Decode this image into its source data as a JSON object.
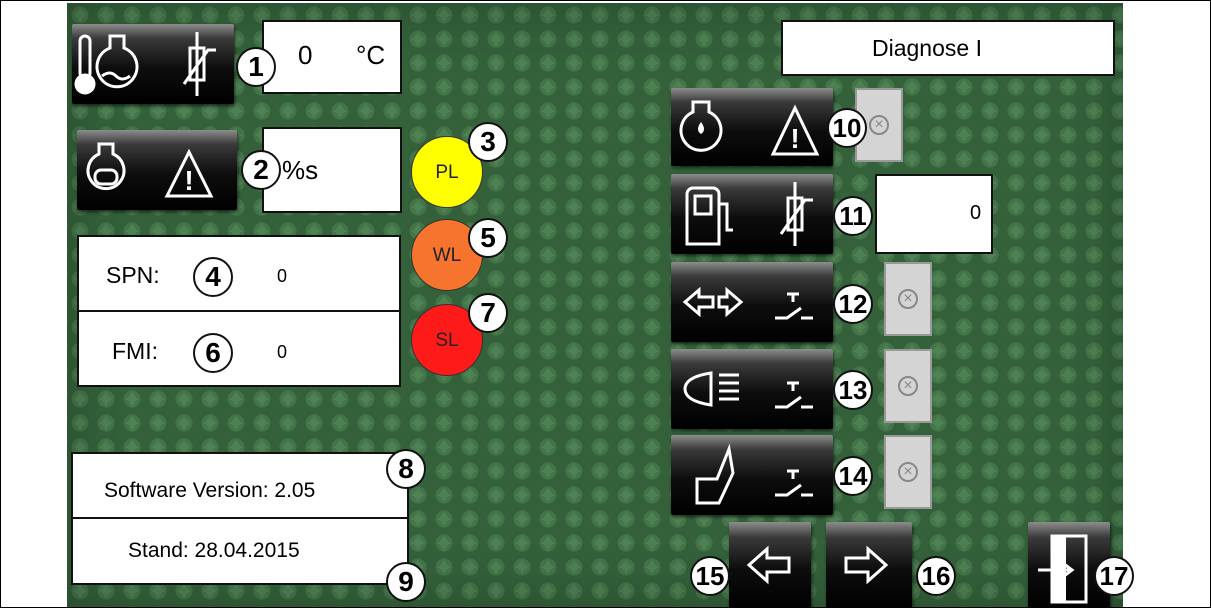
{
  "screen": {
    "title": "Diagnose I"
  },
  "left": {
    "temp_value": "0",
    "temp_unit": "°C",
    "oil_value": "%s",
    "spn_label": "SPN:",
    "spn_value": "0",
    "fmi_label": "FMI:",
    "fmi_value": "0",
    "software_version": "Software Version: 2.05",
    "stand": "Stand: 28.04.2015"
  },
  "lamps": [
    {
      "label": "PL",
      "color": "#ffff00"
    },
    {
      "label": "WL",
      "color": "#f7742e"
    },
    {
      "label": "SL",
      "color": "#ff1a1a"
    }
  ],
  "right": {
    "fuel_value": "0"
  },
  "callouts": [
    "1",
    "2",
    "3",
    "4",
    "5",
    "6",
    "7",
    "8",
    "9",
    "10",
    "11",
    "12",
    "13",
    "14",
    "15",
    "16",
    "17"
  ],
  "icons": {
    "coolant_temp": "thermometer-flask-icon",
    "oil_warning": "engine-warning-icon",
    "water_sep": "water-separator-warning-icon",
    "fuel_sensor": "fuel-pump-sensor-icon",
    "indicator_switch": "turn-signal-switch-icon",
    "light_switch": "headlight-switch-icon",
    "seat_switch": "seat-switch-icon",
    "prev": "arrow-left-icon",
    "next": "arrow-right-icon",
    "exit": "exit-door-icon"
  }
}
